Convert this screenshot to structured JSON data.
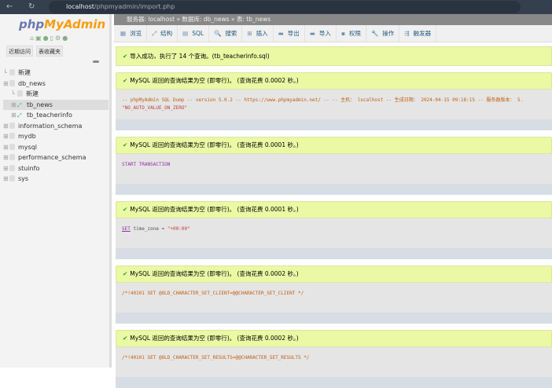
{
  "browser": {
    "url_host": "localhost",
    "url_path": "/phpmyadmin/import.php"
  },
  "sidebar": {
    "logo_php": "php",
    "logo_myadmin": "MyAdmin",
    "recent": "近期访问",
    "favorites": "表收藏夹",
    "tree": [
      {
        "label": "新建",
        "level": 0,
        "type": "new"
      },
      {
        "label": "db_news",
        "level": 0,
        "type": "db"
      },
      {
        "label": "新建",
        "level": 1,
        "type": "new"
      },
      {
        "label": "tb_news",
        "level": 1,
        "type": "table",
        "selected": true
      },
      {
        "label": "tb_teacherinfo",
        "level": 1,
        "type": "table"
      },
      {
        "label": "information_schema",
        "level": 0,
        "type": "db"
      },
      {
        "label": "mydb",
        "level": 0,
        "type": "db"
      },
      {
        "label": "mysql",
        "level": 0,
        "type": "db"
      },
      {
        "label": "performance_schema",
        "level": 0,
        "type": "db"
      },
      {
        "label": "stuinfo",
        "level": 0,
        "type": "db"
      },
      {
        "label": "sys",
        "level": 0,
        "type": "db"
      }
    ]
  },
  "breadcrumb": "服务器: localhost » 数据库: db_news » 表: tb_news",
  "tabs": [
    {
      "label": "浏览",
      "icon": "▦"
    },
    {
      "label": "结构",
      "icon": "⤢"
    },
    {
      "label": "SQL",
      "icon": "▤"
    },
    {
      "label": "搜索",
      "icon": "🔍"
    },
    {
      "label": "插入",
      "icon": "⊞"
    },
    {
      "label": "导出",
      "icon": "▬"
    },
    {
      "label": "导入",
      "icon": "▬"
    },
    {
      "label": "权限",
      "icon": "▪"
    },
    {
      "label": "操作",
      "icon": "🔧"
    },
    {
      "label": "触发器",
      "icon": "⇶"
    }
  ],
  "import_success": "导入成功，执行了 14 个查询。(tb_teacherinfo.sql)",
  "results": [
    {
      "message": "MySQL 返回的查询结果为空 (即零行)。 (查询花费 0.0002 秒。)",
      "sql_line1": "-- phpMyAdmin SQL Dump -- version 5.0.2 -- https://www.phpmyadmin.net/ -- -- 主机： localhost -- 生成日期： 2024-04-15 09:18:15 -- 服务器版本： 5.",
      "sql_line2": "\"NO_AUTO_VALUE_ON_ZERO\""
    },
    {
      "message": "MySQL 返回的查询结果为空 (即零行)。 (查询花费 0.0001 秒。)",
      "sql_line1": "START TRANSACTION"
    },
    {
      "message": "MySQL 返回的查询结果为空 (即零行)。 (查询花费 0.0001 秒。)",
      "sql_kw": "SET",
      "sql_rest": " time_zone = ",
      "sql_str": "\"+00:00\""
    },
    {
      "message": "MySQL 返回的查询结果为空 (即零行)。 (查询花费 0.0002 秒。)",
      "sql_line1": "/*!40101 SET @OLD_CHARACTER_SET_CLIENT=@@CHARACTER_SET_CLIENT */"
    },
    {
      "message": "MySQL 返回的查询结果为空 (即零行)。 (查询花费 0.0002 秒。)",
      "sql_line1": "/*!40101 SET @OLD_CHARACTER_SET_RESULTS=@@CHARACTER_SET_RESULTS */"
    }
  ]
}
